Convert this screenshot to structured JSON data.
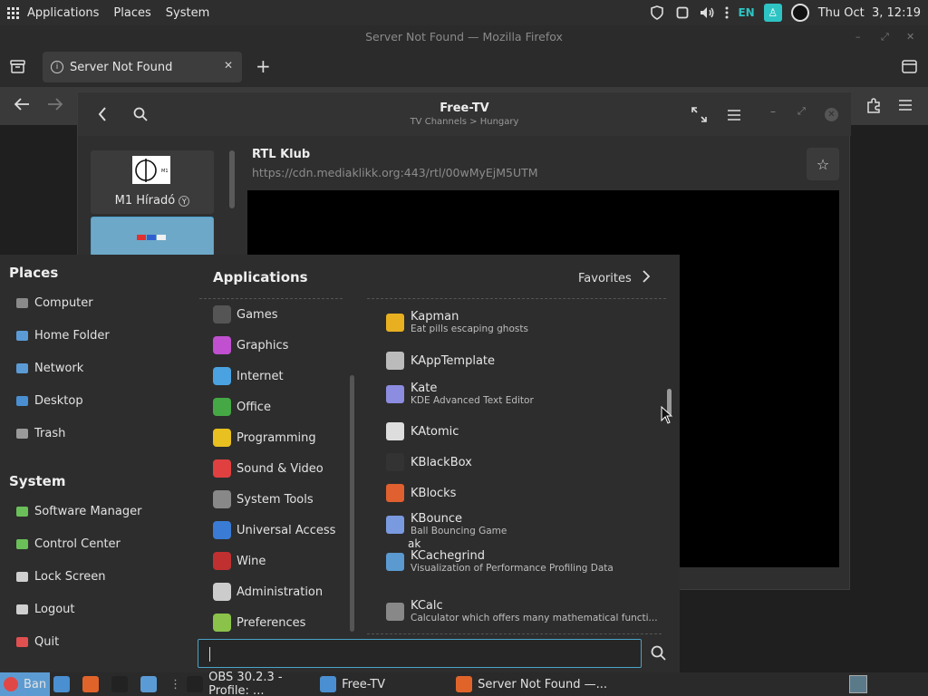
{
  "top_panel": {
    "menus": [
      "Applications",
      "Places",
      "System"
    ],
    "keyboard_layout": "EN",
    "clock": "Thu Oct  3, 12:19"
  },
  "firefox": {
    "window_title": "Server Not Found — Mozilla Firefox",
    "tab_title": "Server Not Found",
    "new_tab_symbol": "+"
  },
  "freetv": {
    "title": "Free-TV",
    "breadcrumb": "TV Channels > Hungary",
    "channels": [
      {
        "name": "M1 Híradó",
        "badge": "Y"
      }
    ],
    "selected_channel": {
      "name": "RTL Klub",
      "url": "https://cdn.mediaklikk.org:443/rtl/00wMyEjM5UTM"
    }
  },
  "app_menu": {
    "places_heading": "Places",
    "places": [
      {
        "label": "Computer",
        "icon": "computer-icon",
        "color": "#8a8a8a"
      },
      {
        "label": "Home Folder",
        "icon": "home-folder-icon",
        "color": "#5b9bd5"
      },
      {
        "label": "Network",
        "icon": "network-icon",
        "color": "#5b9bd5"
      },
      {
        "label": "Desktop",
        "icon": "desktop-icon",
        "color": "#4a8fd1"
      },
      {
        "label": "Trash",
        "icon": "trash-icon",
        "color": "#9a9a9a"
      }
    ],
    "system_heading": "System",
    "system": [
      {
        "label": "Software Manager",
        "icon": "software-manager-icon",
        "color": "#6bbf59"
      },
      {
        "label": "Control Center",
        "icon": "control-center-icon",
        "color": "#6bbf59"
      },
      {
        "label": "Lock Screen",
        "icon": "lock-icon",
        "color": "#cfcfcf"
      },
      {
        "label": "Logout",
        "icon": "logout-icon",
        "color": "#cfcfcf"
      },
      {
        "label": "Quit",
        "icon": "quit-icon",
        "color": "#e05050"
      }
    ],
    "applications_heading": "Applications",
    "favorites_label": "Favorites",
    "categories": [
      {
        "label": "Games",
        "icon": "games-icon",
        "color": "#555555"
      },
      {
        "label": "Graphics",
        "icon": "graphics-icon",
        "color": "#c050d0"
      },
      {
        "label": "Internet",
        "icon": "internet-icon",
        "color": "#4aa3e0"
      },
      {
        "label": "Office",
        "icon": "office-icon",
        "color": "#45a845"
      },
      {
        "label": "Programming",
        "icon": "programming-icon",
        "color": "#e8c020"
      },
      {
        "label": "Sound & Video",
        "icon": "sound-video-icon",
        "color": "#e04040"
      },
      {
        "label": "System Tools",
        "icon": "system-tools-icon",
        "color": "#888888"
      },
      {
        "label": "Universal Access",
        "icon": "universal-access-icon",
        "color": "#3a7bd5"
      },
      {
        "label": "Wine",
        "icon": "wine-icon",
        "color": "#c03030"
      },
      {
        "label": "Administration",
        "icon": "administration-icon",
        "color": "#cccccc"
      },
      {
        "label": "Preferences",
        "icon": "preferences-icon",
        "color": "#8bc34a"
      }
    ],
    "apps": [
      {
        "name": "Kapman",
        "desc": "Eat pills escaping ghosts",
        "icon": "kapman-icon",
        "color": "#e8b020"
      },
      {
        "name": "KAppTemplate",
        "desc": "",
        "icon": "kapptemplate-icon",
        "color": "#bbbbbb"
      },
      {
        "name": "Kate",
        "desc": "KDE Advanced Text Editor",
        "icon": "kate-icon",
        "color": "#8c8ce0"
      },
      {
        "name": "KAtomic",
        "desc": "",
        "icon": "katomic-icon",
        "color": "#dddddd"
      },
      {
        "name": "KBlackBox",
        "desc": "",
        "icon": "kblackbox-icon",
        "color": "#333333"
      },
      {
        "name": "KBlocks",
        "desc": "",
        "icon": "kblocks-icon",
        "color": "#e06030"
      },
      {
        "name": "KBounce",
        "desc": "Ball Bouncing Game",
        "icon": "kbounce-icon",
        "color": "#7a9ae0"
      },
      {
        "name": "KCachegrind",
        "desc": "Visualization of Performance Profiling Data",
        "icon": "kcachegrind-icon",
        "color": "#5a9ad0",
        "prefix": "ak"
      },
      {
        "name": "KCalc",
        "desc": "Calculator which offers many mathematical functi...",
        "icon": "kcalc-icon",
        "color": "#888888"
      }
    ],
    "search_placeholder": ""
  },
  "taskbar": {
    "items": [
      {
        "label": "Ban",
        "icon": "ban-icon",
        "color": "#e04848"
      },
      {
        "label": "",
        "icon": "show-desktop-icon",
        "color": "#4a8fd1"
      },
      {
        "label": "",
        "icon": "ubuntu-software-icon",
        "color": "#e0642a"
      },
      {
        "label": "",
        "icon": "terminal-icon",
        "color": "#222222"
      },
      {
        "label": "",
        "icon": "files-icon",
        "color": "#5b9bd5"
      },
      {
        "label": "OBS 30.2.3 - Profile: ...",
        "icon": "obs-icon",
        "color": "#222222"
      },
      {
        "label": "Free-TV",
        "icon": "freetv-icon",
        "color": "#4a8fd1"
      },
      {
        "label": "Server Not Found —...",
        "icon": "firefox-icon",
        "color": "#e0642a"
      }
    ]
  }
}
